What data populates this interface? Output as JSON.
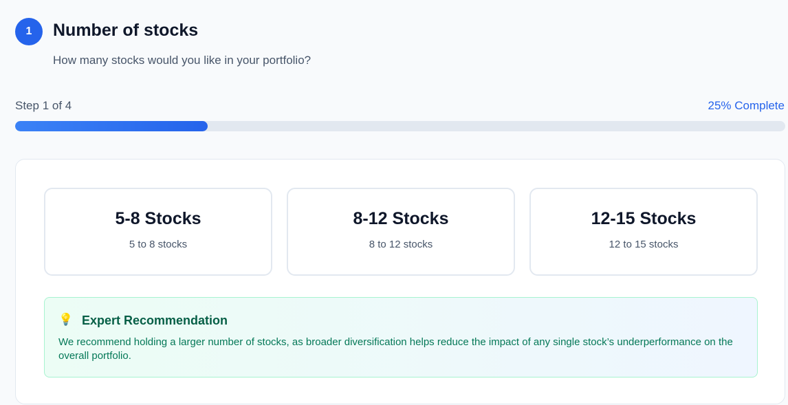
{
  "step": {
    "number": "1",
    "title": "Number of stocks",
    "subtitle": "How many stocks would you like in your portfolio?"
  },
  "progress": {
    "label": "Step 1 of 4",
    "percent_label": "25% Complete",
    "percent": 25
  },
  "options": [
    {
      "title": "5-8 Stocks",
      "desc": "5 to 8 stocks"
    },
    {
      "title": "8-12 Stocks",
      "desc": "8 to 12 stocks"
    },
    {
      "title": "12-15 Stocks",
      "desc": "12 to 15 stocks"
    }
  ],
  "recommendation": {
    "icon": "lightbulb-icon",
    "title": "Expert Recommendation",
    "text": "We recommend holding a larger number of stocks, as broader diversification helps reduce the impact of any single stock’s underperformance on the overall portfolio."
  },
  "colors": {
    "accent": "#2563eb",
    "progress_track": "#e2e8f0",
    "recommendation_text": "#047857"
  }
}
